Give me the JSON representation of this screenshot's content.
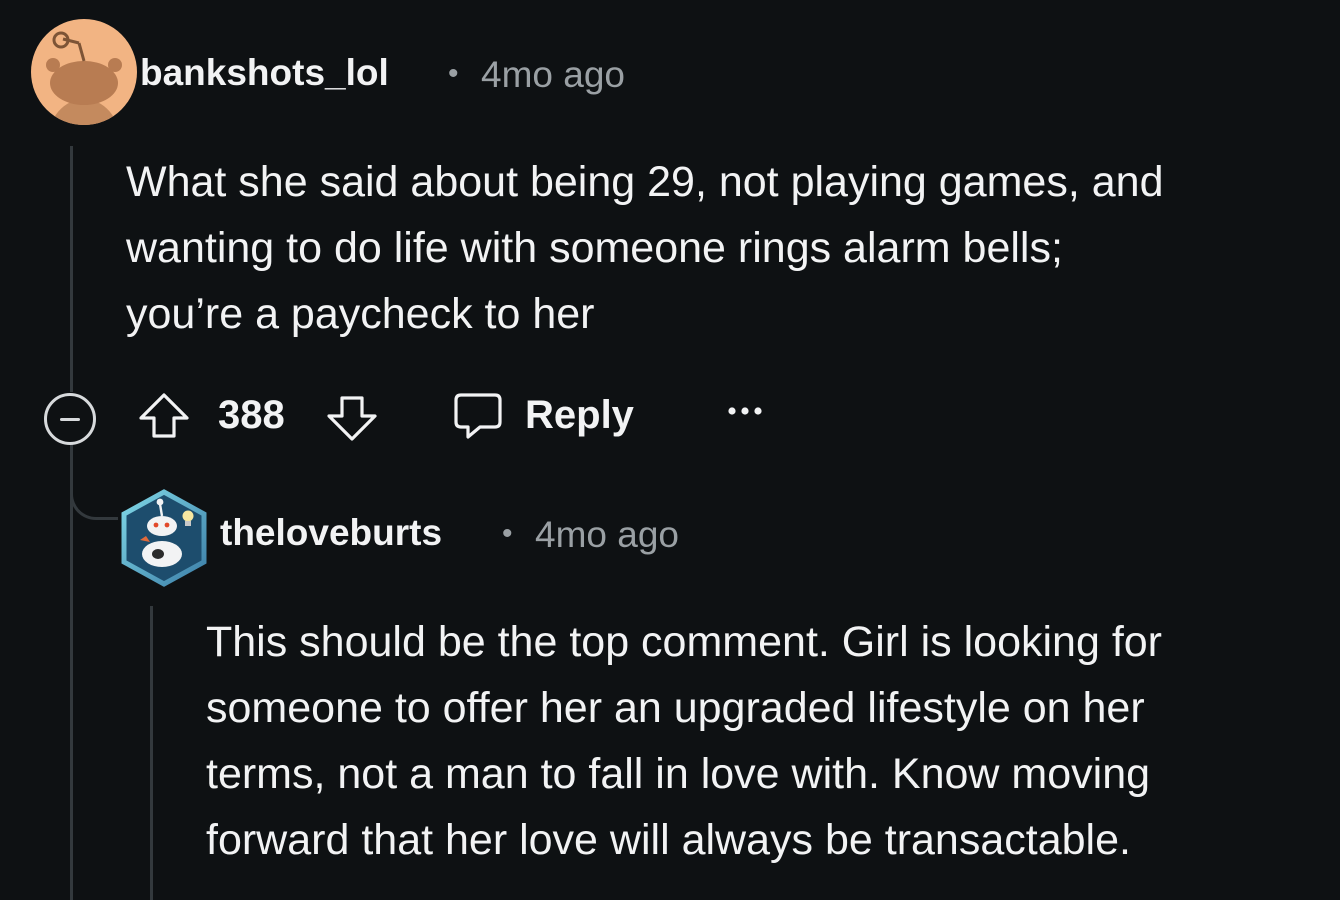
{
  "comments": [
    {
      "author": "bankshots_lol",
      "separator": "•",
      "age": "4mo ago",
      "body_lines": [
        "What she said about being 29, not playing games, and",
        "wanting to do life with someone rings alarm bells;",
        "you’re a paycheck to her"
      ],
      "votes": "388",
      "reply_label": "Reply",
      "more_label": "•••"
    },
    {
      "author": "theloveburts",
      "separator": "•",
      "age": "4mo ago",
      "body_lines": [
        "This should be the top comment. Girl is looking for",
        "someone to offer her an upgraded lifestyle on her",
        "terms, not a man to fall in love with. Know moving",
        "forward that her love will always be transactable."
      ]
    }
  ],
  "colors": {
    "background": "#0e1113",
    "text": "#f2f3f4",
    "muted": "#9aa0a4",
    "thread_line": "#33393d",
    "avatar_1": "#f2b483"
  },
  "icons": {
    "collapse": "minus-circle-icon",
    "upvote": "arrow-up-icon",
    "downvote": "arrow-down-icon",
    "reply": "speech-bubble-icon",
    "more": "ellipsis-icon"
  }
}
